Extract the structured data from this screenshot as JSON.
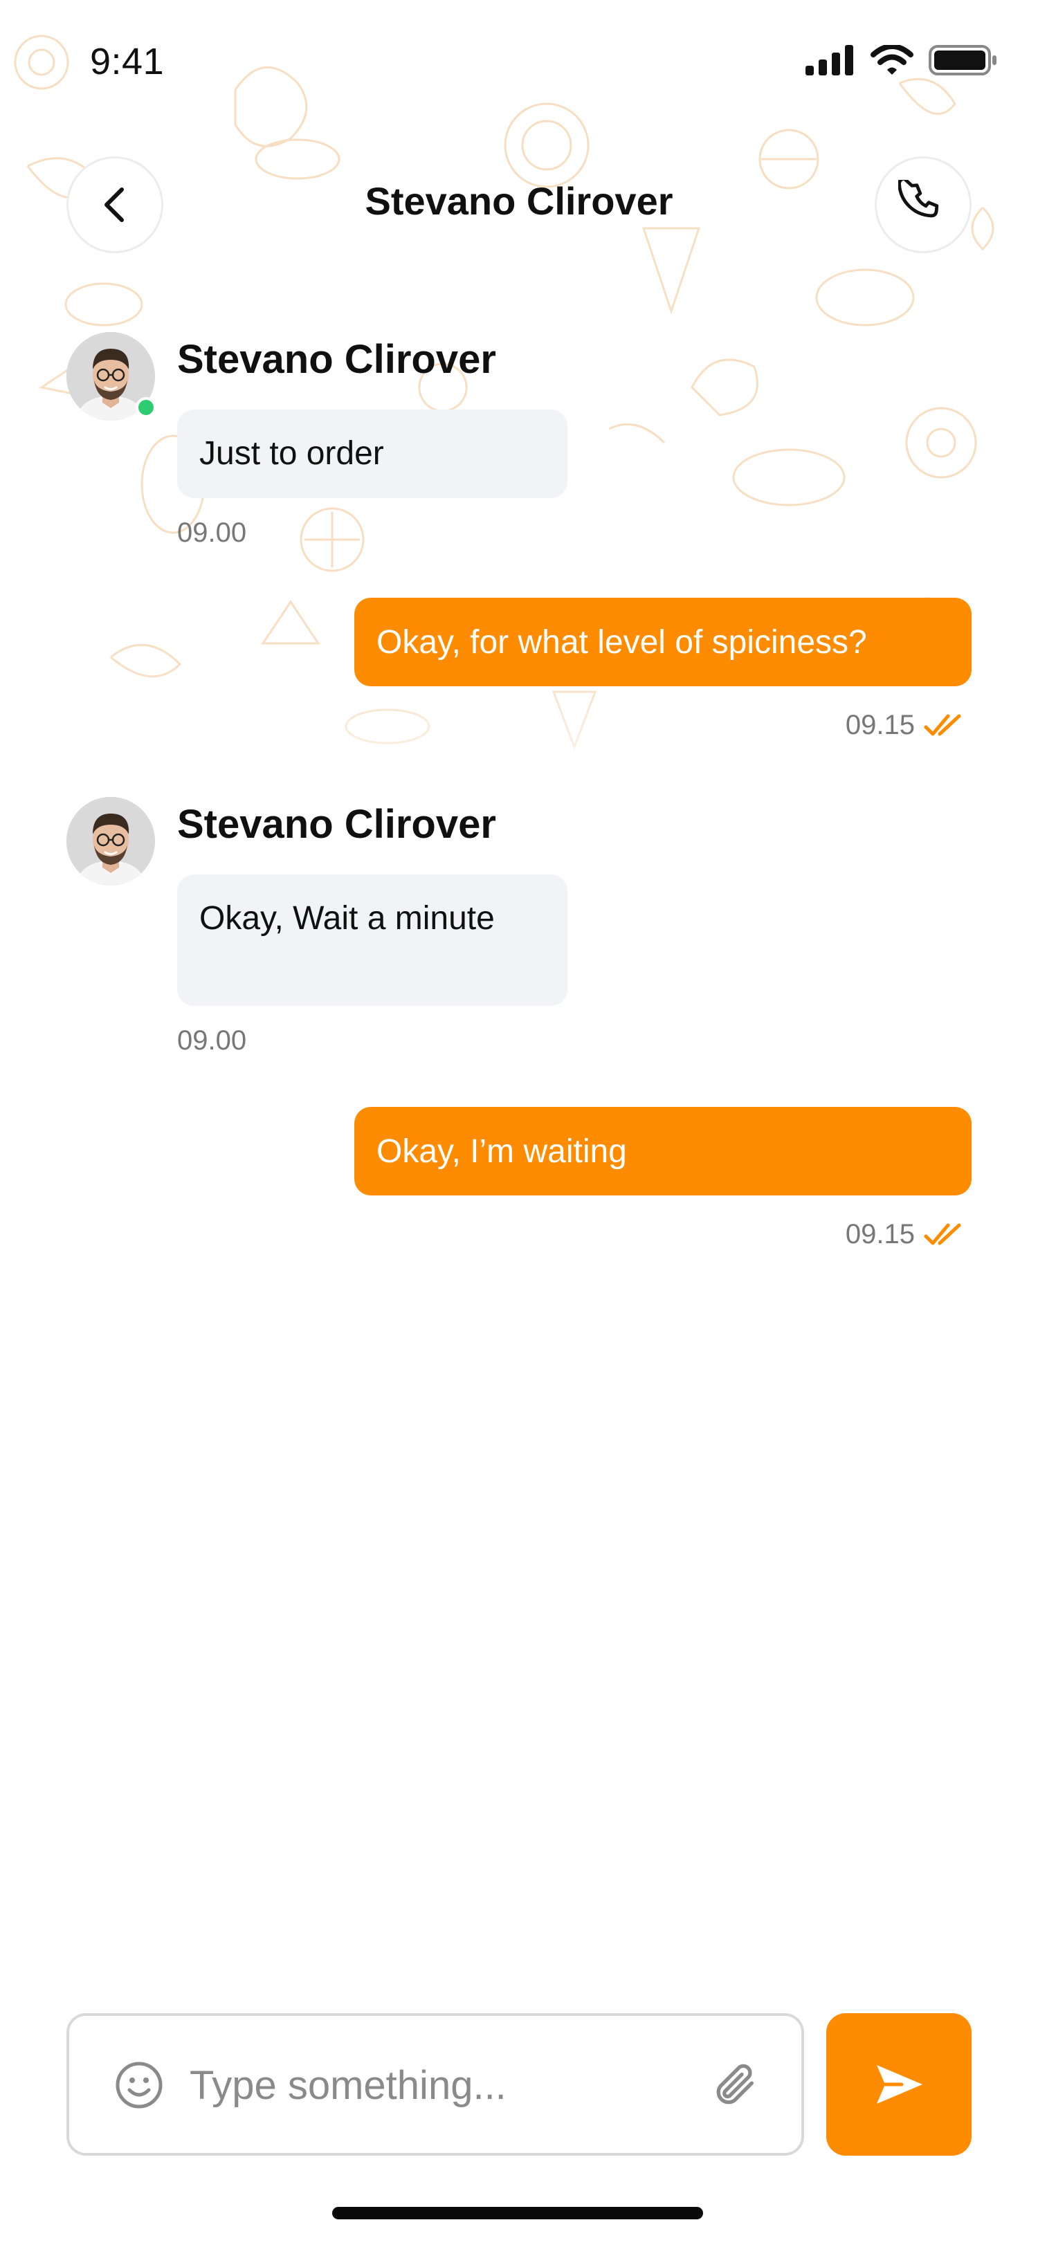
{
  "status_bar": {
    "time": "9:41"
  },
  "header": {
    "title": "Stevano Clirover"
  },
  "messages": [
    {
      "direction": "incoming",
      "sender": "Stevano Clirover",
      "text": "Just to order",
      "time": "09.00",
      "online": true
    },
    {
      "direction": "outgoing",
      "text": "Okay, for what level of spiciness?",
      "time": "09.15",
      "status": "read"
    },
    {
      "direction": "incoming",
      "sender": "Stevano Clirover",
      "text": "Okay, Wait a minute",
      "time": "09.00",
      "online": false
    },
    {
      "direction": "outgoing",
      "text": "Okay, I’m waiting",
      "time": "09.15",
      "status": "read"
    }
  ],
  "composer": {
    "placeholder": "Type something...",
    "value": ""
  },
  "icons": {
    "back": "chevron-left-icon",
    "call": "phone-icon",
    "emoji": "smiley-icon",
    "attach": "paperclip-icon",
    "send": "send-icon",
    "read_receipt": "double-check-icon"
  },
  "colors": {
    "accent": "#FF8C00",
    "incoming_bubble": "#F2F3F6",
    "online": "#2ECC71",
    "muted_text": "#777777"
  }
}
